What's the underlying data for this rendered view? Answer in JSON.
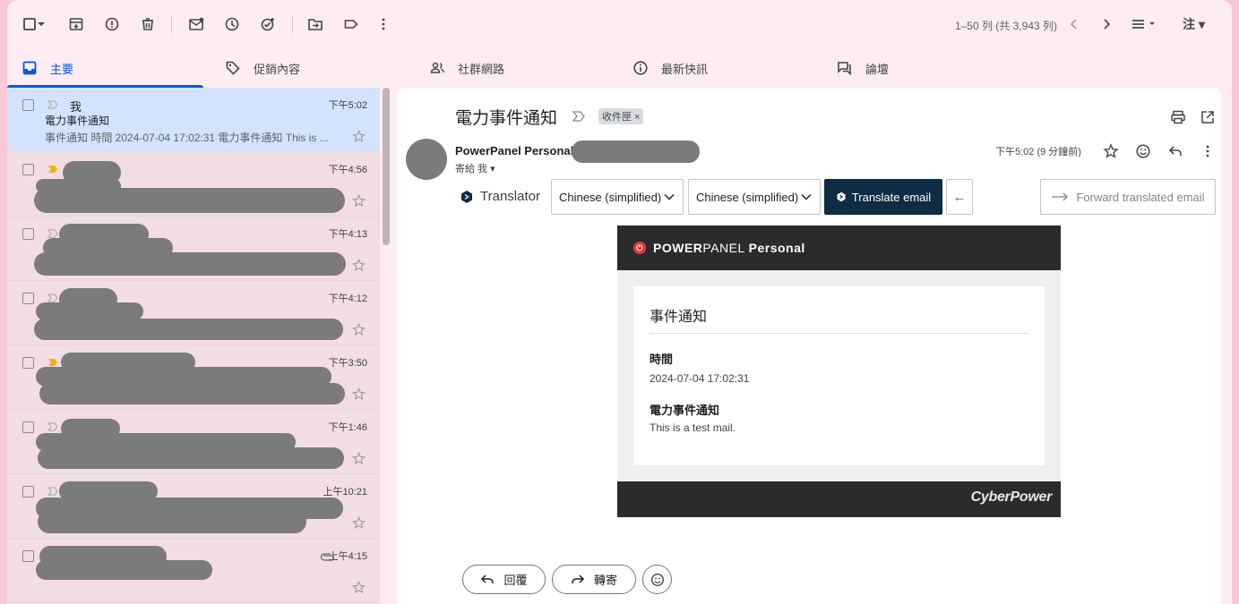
{
  "toolbar": {
    "pager": "1–50 列 (共 3,943 列)",
    "lang": "注"
  },
  "tabs": [
    {
      "label": "主要"
    },
    {
      "label": "促銷內容"
    },
    {
      "label": "社群網路"
    },
    {
      "label": "最新快訊"
    },
    {
      "label": "論壇"
    }
  ],
  "list": [
    {
      "sender": "我",
      "subject": "電力事件通知",
      "snippet": "事件通知 時間 2024-07-04 17:02:31 電力事件通知 This is ...",
      "time": "下午5:02"
    },
    {
      "time": "下午4:56"
    },
    {
      "time": "下午4:13"
    },
    {
      "time": "下午4:12"
    },
    {
      "time": "下午3:50"
    },
    {
      "time": "下午1:46"
    },
    {
      "time": "上午10:21"
    },
    {
      "time": "上午4:15"
    }
  ],
  "mail": {
    "subject": "電力事件通知",
    "label": "收件匣 ×",
    "sender_name": "PowerPanel Personal",
    "to": "寄給 我",
    "time": "下午5:02 (9 分鐘前)"
  },
  "translator": {
    "title": "Translator",
    "from_lang": "Chinese (simplified)",
    "to_lang": "Chinese (simplified)",
    "translate_btn": "Translate email",
    "back_arrow": "←",
    "forward_btn": "Forward translated email"
  },
  "email_body": {
    "brand_bold1": "POWER",
    "brand_light": "PANEL",
    "brand_bold2": "Personal",
    "card_title": "事件通知",
    "time_label": "時間",
    "time_value": "2024-07-04 17:02:31",
    "event_label": "電力事件通知",
    "event_value": "This is a test mail.",
    "footer_brand": "CyberPower"
  },
  "reply": {
    "reply_label": "回覆",
    "forward_label": "轉寄"
  }
}
